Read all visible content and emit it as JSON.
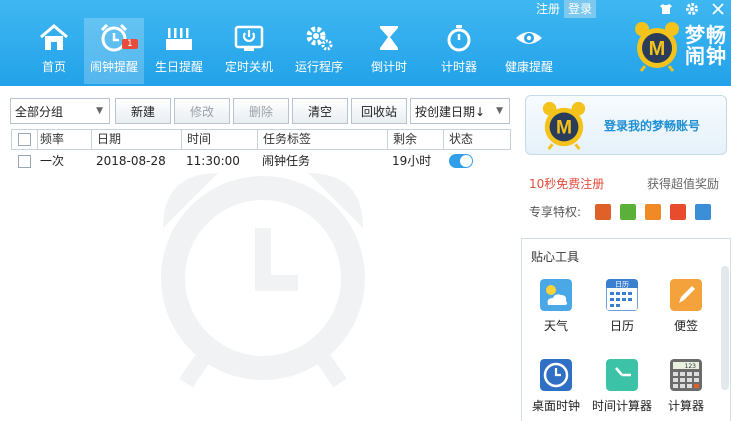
{
  "top_links": {
    "register": "注册",
    "login": "登录"
  },
  "nav": [
    {
      "label": "首页",
      "icon": "home-icon"
    },
    {
      "label": "闹钟提醒",
      "icon": "alarm-clock-icon",
      "badge": "1",
      "active": true
    },
    {
      "label": "生日提醒",
      "icon": "birthday-cake-icon"
    },
    {
      "label": "定时关机",
      "icon": "power-icon"
    },
    {
      "label": "运行程序",
      "icon": "gear-icon"
    },
    {
      "label": "倒计时",
      "icon": "hourglass-icon"
    },
    {
      "label": "计时器",
      "icon": "stopwatch-icon"
    },
    {
      "label": "健康提醒",
      "icon": "eye-icon"
    }
  ],
  "logo": {
    "line1": "梦畅",
    "line2": "闹钟"
  },
  "toolbar": {
    "group_select": "全部分组",
    "new": "新建",
    "edit": "修改",
    "delete": "删除",
    "clear": "清空",
    "recycle": "回收站",
    "sort_select": "按创建日期↓"
  },
  "table": {
    "columns": [
      "频率",
      "日期",
      "时间",
      "任务标签",
      "剩余",
      "状态"
    ],
    "rows": [
      {
        "freq": "一次",
        "date": "2018-08-28",
        "time": "11:30:00",
        "label": "闹钟任务",
        "remaining": "19小时",
        "enabled": true
      }
    ]
  },
  "login_card": {
    "text": "登录我的梦畅账号"
  },
  "register_link": "10秒免费注册",
  "reward_link": "获得超值奖励",
  "privilege_label": "专享特权:",
  "privilege_icons": [
    "gift-icon",
    "leaf-icon",
    "card-icon",
    "present-icon",
    "printer-icon"
  ],
  "tools": {
    "title": "贴心工具",
    "items": [
      {
        "label": "天气",
        "icon": "weather-icon"
      },
      {
        "label": "日历",
        "icon": "calendar-icon",
        "icon_text": "日历"
      },
      {
        "label": "便签",
        "icon": "notepad-icon"
      },
      {
        "label": "桌面时钟",
        "icon": "desktop-clock-icon"
      },
      {
        "label": "时间计算器",
        "icon": "time-calculator-icon"
      },
      {
        "label": "计算器",
        "icon": "calculator-icon",
        "icon_text": "123"
      }
    ]
  },
  "colors": {
    "header_blue": "#2aa8ec",
    "accent_blue": "#1f8fd4",
    "register_red": "#e64b3c"
  }
}
